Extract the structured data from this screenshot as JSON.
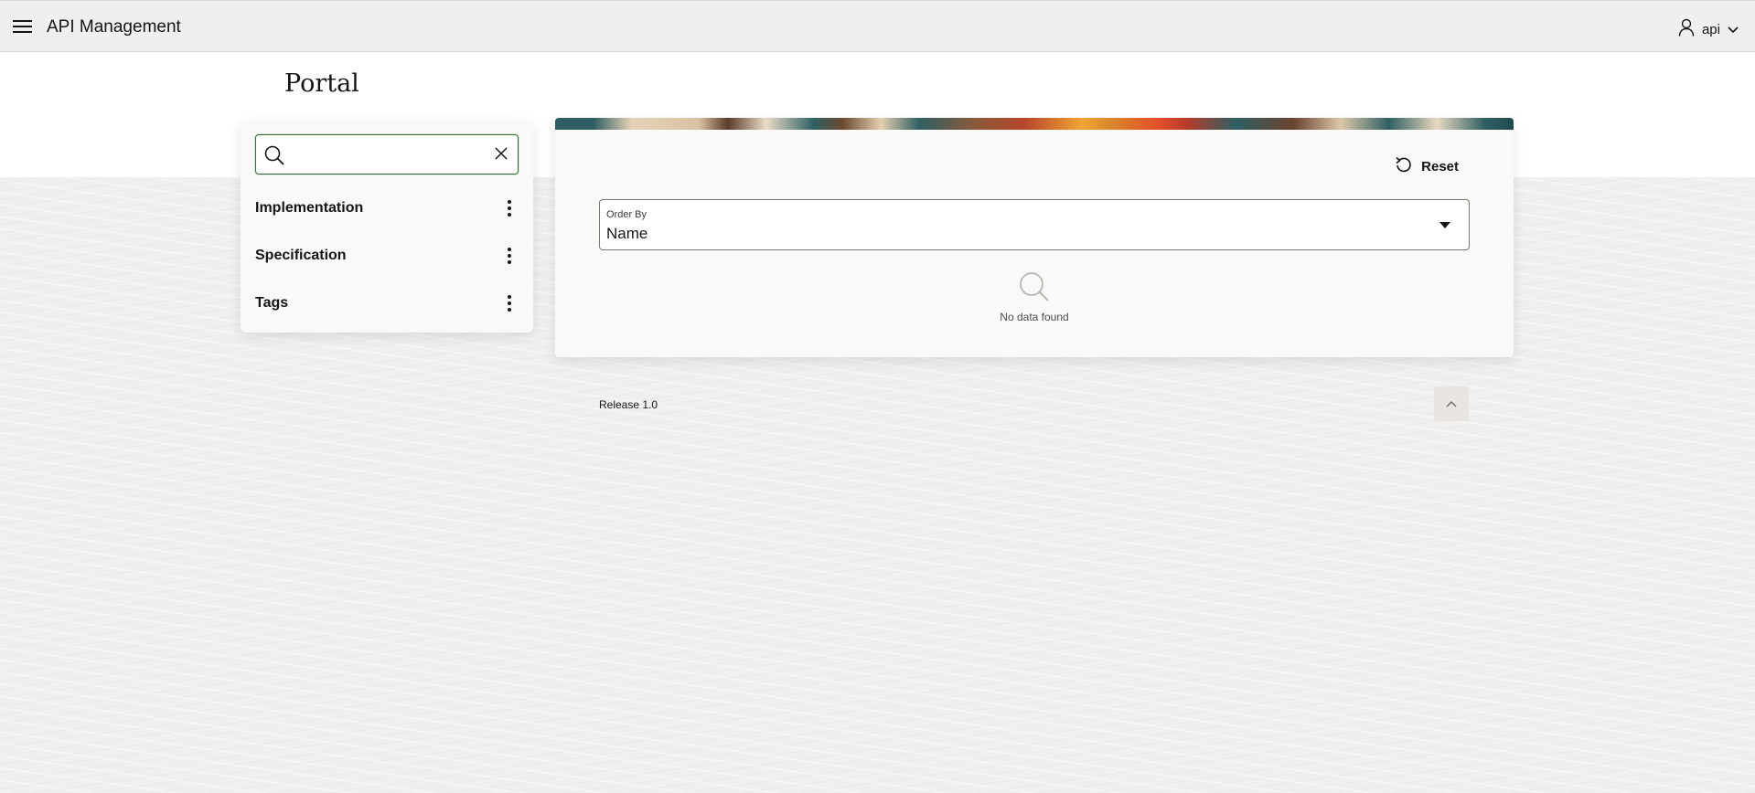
{
  "header": {
    "app_title": "API Management",
    "menu_icon": "hamburger-icon",
    "user": {
      "name": "api",
      "icon": "user-icon",
      "dropdown_icon": "chevron-down-icon"
    }
  },
  "page": {
    "title": "Portal"
  },
  "facets": {
    "search": {
      "value": "",
      "placeholder": "",
      "search_icon": "search-icon",
      "clear_icon": "close-icon"
    },
    "items": [
      {
        "label": "Implementation",
        "menu_icon": "kebab-icon"
      },
      {
        "label": "Specification",
        "menu_icon": "kebab-icon"
      },
      {
        "label": "Tags",
        "menu_icon": "kebab-icon"
      }
    ]
  },
  "results": {
    "reset_label": "Reset",
    "reset_icon": "undo-icon",
    "order_by": {
      "label": "Order By",
      "value": "Name"
    },
    "empty_text": "No data found",
    "empty_icon": "search-icon"
  },
  "footer": {
    "release": "Release 1.0",
    "scroll_top_icon": "chevron-up-icon"
  },
  "colors": {
    "page_bg": "#f1efed",
    "card_bg": "#fbf9f8",
    "focus_border": "#3a6b3a",
    "text": "#161513"
  }
}
